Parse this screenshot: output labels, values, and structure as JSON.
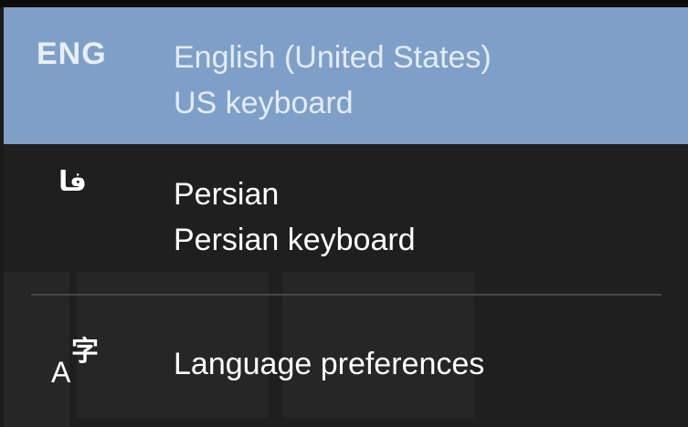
{
  "flyout": {
    "languages": [
      {
        "abbr": "ENG",
        "name": "English (United States)",
        "keyboard": "US keyboard",
        "selected": true
      },
      {
        "abbr": "فا",
        "name": "Persian",
        "keyboard": "Persian keyboard",
        "selected": false
      }
    ],
    "preferences_label": "Language preferences",
    "preferences_icon": "language-settings-icon"
  },
  "colors": {
    "selected_background": "#7ea0c8",
    "flyout_background": "#1f1f1f",
    "divider": "#474747",
    "text": "#ffffff"
  }
}
